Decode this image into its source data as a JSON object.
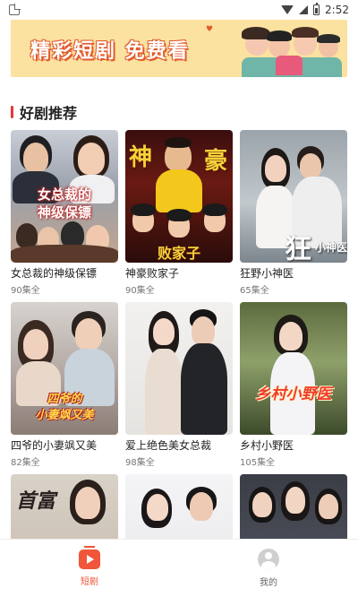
{
  "status_bar": {
    "time": "2:52"
  },
  "banner": {
    "text": "精彩短剧 免费看"
  },
  "section": {
    "title": "好剧推荐"
  },
  "dramas": [
    {
      "name": "女总裁的神级保镖",
      "episodes": "90集全",
      "poster_text": "女总裁的\n神级保镖"
    },
    {
      "name": "神豪败家子",
      "episodes": "90集全",
      "poster_text": "神  豪"
    },
    {
      "name": "狂野小神医",
      "episodes": "65集全",
      "poster_text": "狂 小神医"
    },
    {
      "name": "四爷的小妻飒又美",
      "episodes": "82集全",
      "poster_text": "四爷的\n小妻飒又美"
    },
    {
      "name": "爱上绝色美女总裁",
      "episodes": "98集全",
      "poster_text": ""
    },
    {
      "name": "乡村小野医",
      "episodes": "105集全",
      "poster_text": "乡村小野医"
    },
    {
      "name": "",
      "episodes": "",
      "poster_text": "首富"
    },
    {
      "name": "",
      "episodes": "",
      "poster_text": ""
    },
    {
      "name": "",
      "episodes": "",
      "poster_text": ""
    }
  ],
  "bottom_nav": {
    "items": [
      {
        "label": "短剧",
        "icon": "play-icon",
        "active": true
      },
      {
        "label": "我的",
        "icon": "user-icon",
        "active": false
      }
    ]
  },
  "colors": {
    "accent": "#f0563a",
    "section_bar": "#e8323c",
    "banner_bg": "#fbe2a0"
  }
}
